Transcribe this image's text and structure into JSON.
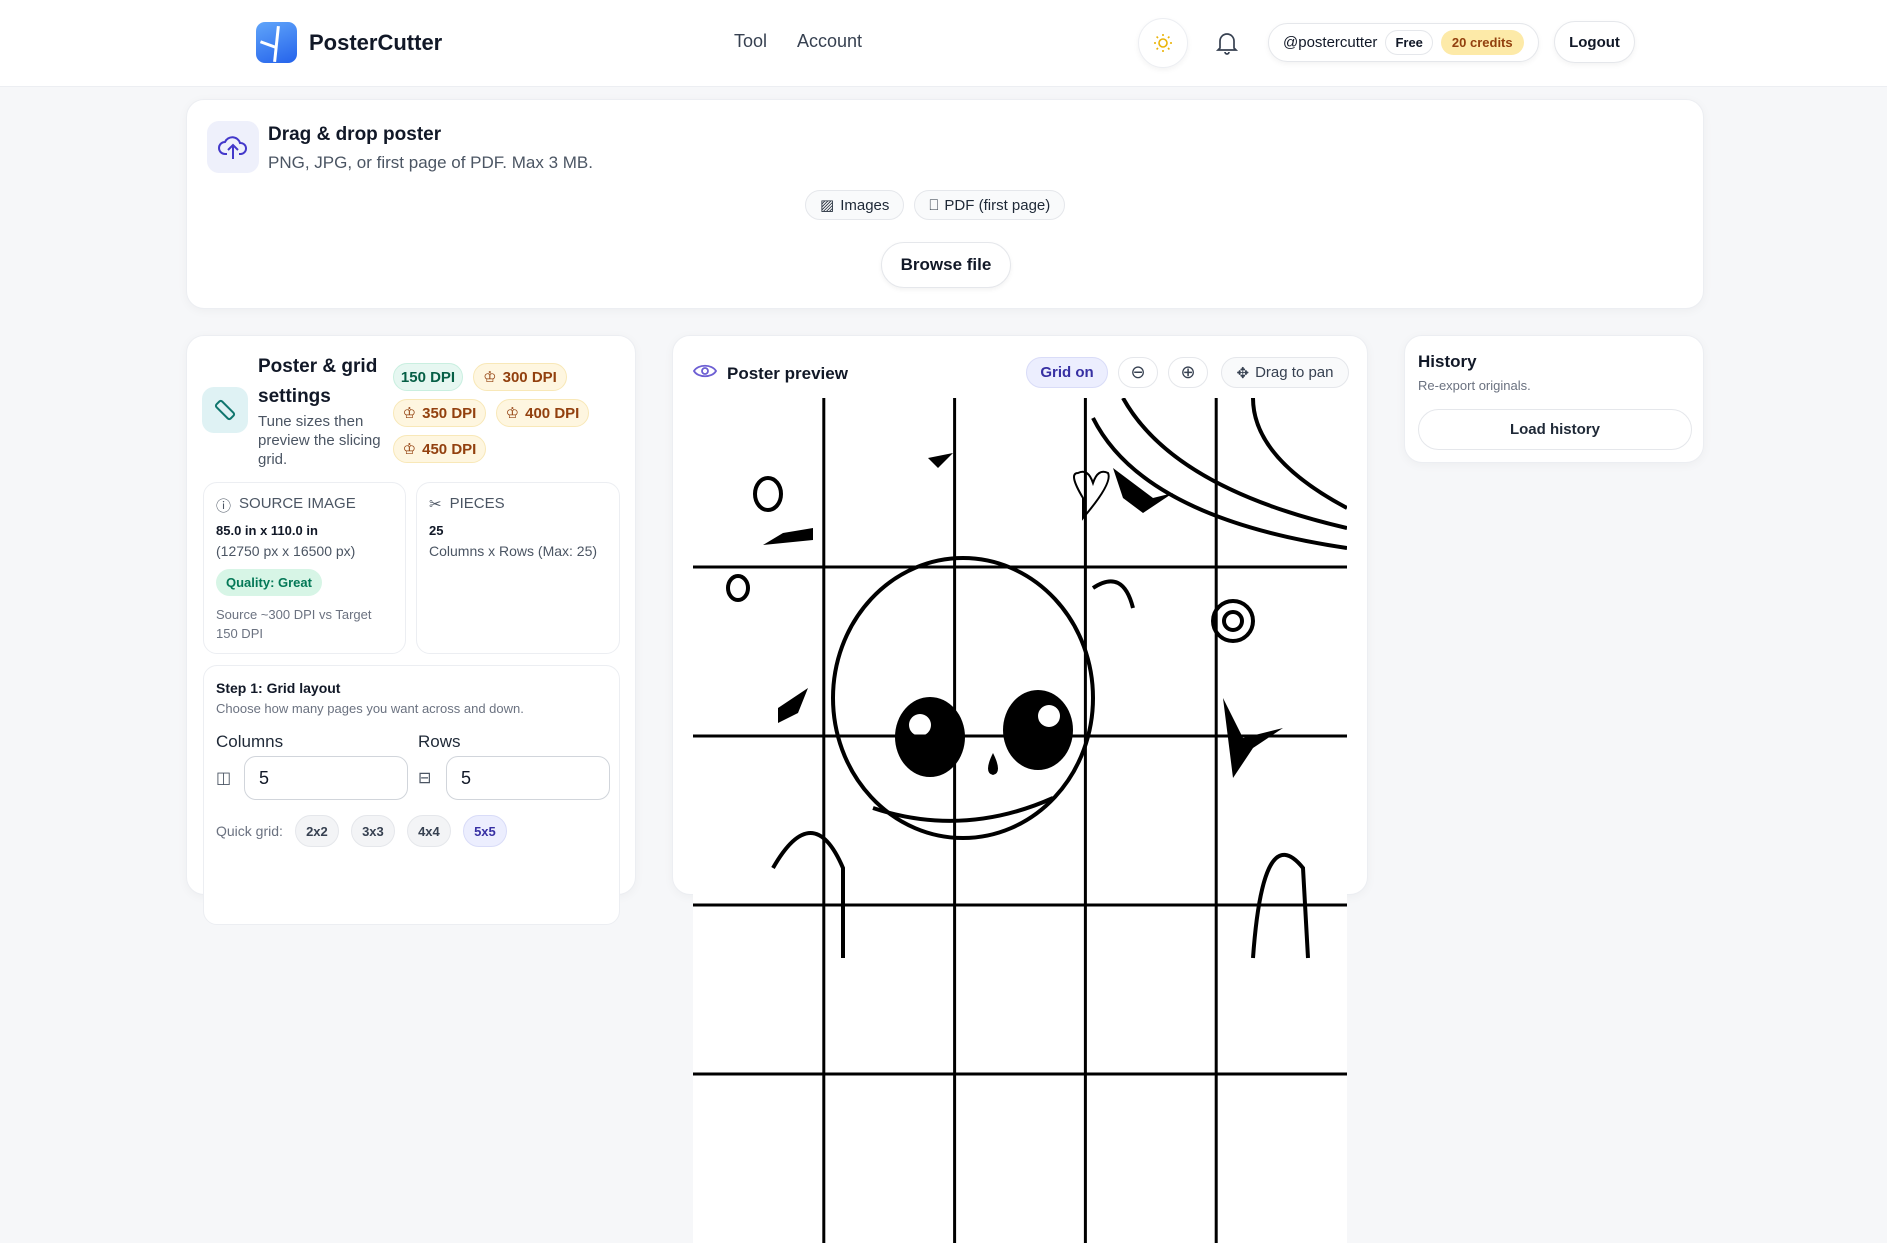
{
  "header": {
    "brand": "PosterCutter",
    "nav": [
      "Tool",
      "Account"
    ],
    "username": "@postercutter",
    "plan": "Free",
    "credits": "20 credits",
    "logout": "Logout"
  },
  "upload": {
    "title": "Drag & drop poster",
    "subtitle": "PNG, JPG, or first page of PDF. Max 3 MB.",
    "chips": [
      "Images",
      "PDF (first page)"
    ],
    "browse": "Browse file"
  },
  "settings": {
    "title": "Poster & grid settings",
    "subtitle": "Tune sizes then preview the slicing grid.",
    "dpi": [
      "150 DPI",
      "300 DPI",
      "350 DPI",
      "400 DPI",
      "450 DPI"
    ],
    "source": {
      "label": "SOURCE IMAGE",
      "size": "85.0 in x 110.0 in",
      "pixels": "(12750 px x 16500 px)",
      "quality": "Quality: Great",
      "note": "Source ~300 DPI vs Target 150 DPI"
    },
    "pieces": {
      "label": "PIECES",
      "count": "25",
      "note": "Columns x Rows (Max: 25)"
    },
    "step1": {
      "title": "Step 1: Grid layout",
      "desc": "Choose how many pages you want across and down.",
      "columns_label": "Columns",
      "rows_label": "Rows",
      "columns": "5",
      "rows": "5",
      "quick_label": "Quick grid:",
      "quick": [
        "2x2",
        "3x3",
        "4x4",
        "5x5"
      ]
    }
  },
  "preview": {
    "title": "Poster preview",
    "grid": "Grid on",
    "pan": "Drag to pan",
    "columns": 5,
    "rows": 5
  },
  "history": {
    "title": "History",
    "subtitle": "Re-export originals.",
    "button": "Load history"
  },
  "colors": {
    "accent": "#4f46e5",
    "free": "#065f46",
    "pro": "#92400e"
  }
}
